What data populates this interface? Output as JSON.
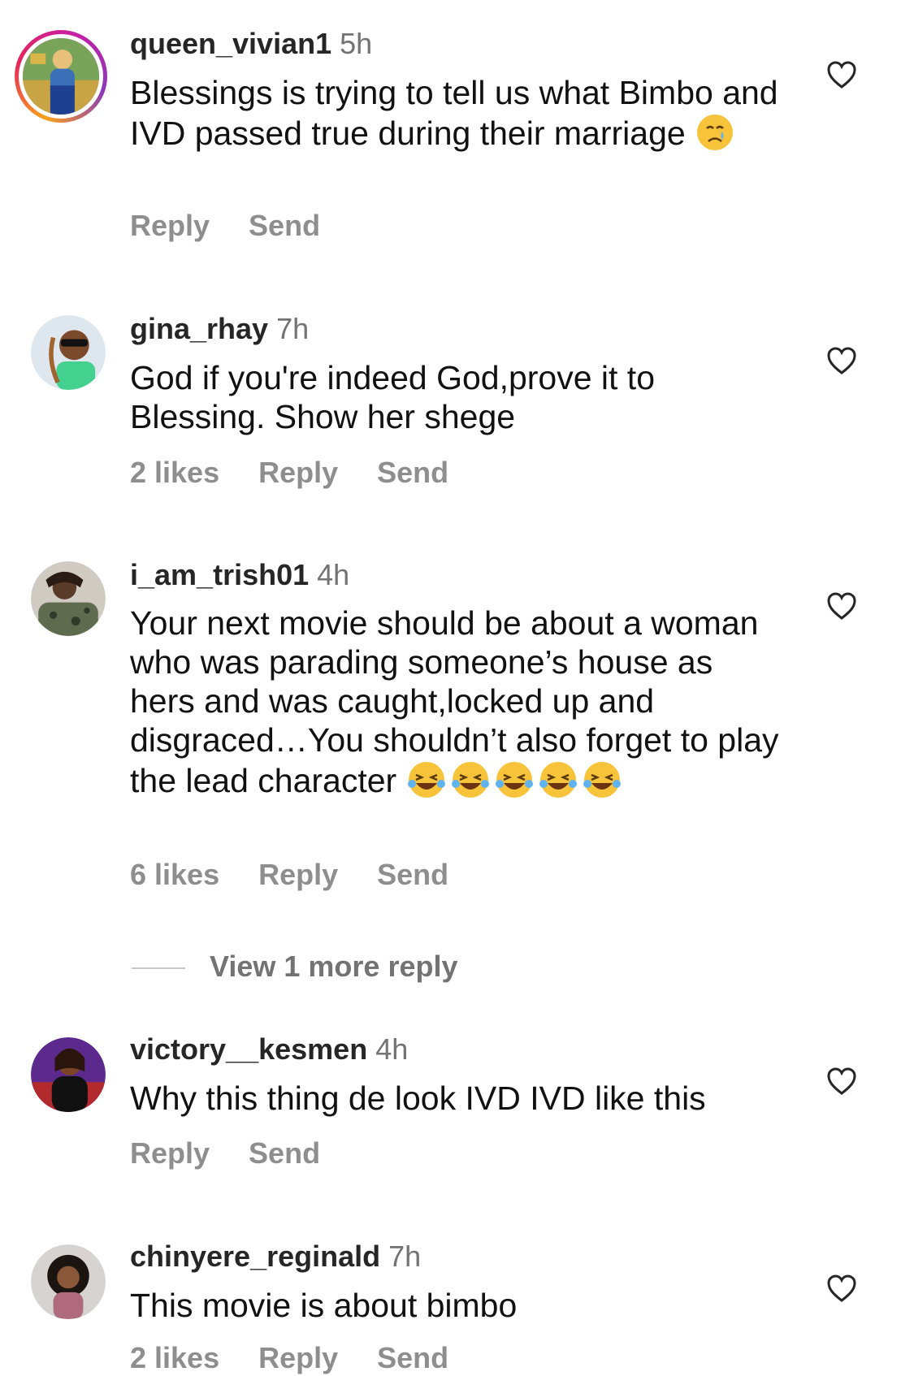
{
  "comments": [
    {
      "username": "queen_vivian1",
      "time": "5h",
      "text": "Blessings is trying to tell us what Bimbo and IVD passed true during their marriage",
      "emoji": "😢",
      "likes": "",
      "reply": "Reply",
      "send": "Send"
    },
    {
      "username": "gina_rhay",
      "time": "7h",
      "text": "God if you're indeed God,prove it to Blessing. Show her shege",
      "likes": "2 likes",
      "reply": "Reply",
      "send": "Send"
    },
    {
      "username": "i_am_trish01",
      "time": "4h",
      "text": "Your next movie should be about a woman who was parading someone’s house as hers and was caught,locked up and disgraced…You shouldn’t also forget to play the lead character",
      "emoji": "😂😂😂😂😂",
      "likes": "6 likes",
      "reply": "Reply",
      "send": "Send",
      "view_more": "View 1 more reply"
    },
    {
      "username": "victory__kesmen",
      "time": "4h",
      "text": "Why this thing de look IVD IVD like this",
      "likes": "",
      "reply": "Reply",
      "send": "Send"
    },
    {
      "username": "chinyere_reginald",
      "time": "7h",
      "text": "This movie is about bimbo",
      "likes": "2 likes",
      "reply": "Reply",
      "send": "Send"
    }
  ],
  "icons": {
    "like": "heart-outline-icon"
  },
  "colors": {
    "username": "#262626",
    "meta": "#8e8e8e",
    "story_ring": "#e6245e"
  }
}
